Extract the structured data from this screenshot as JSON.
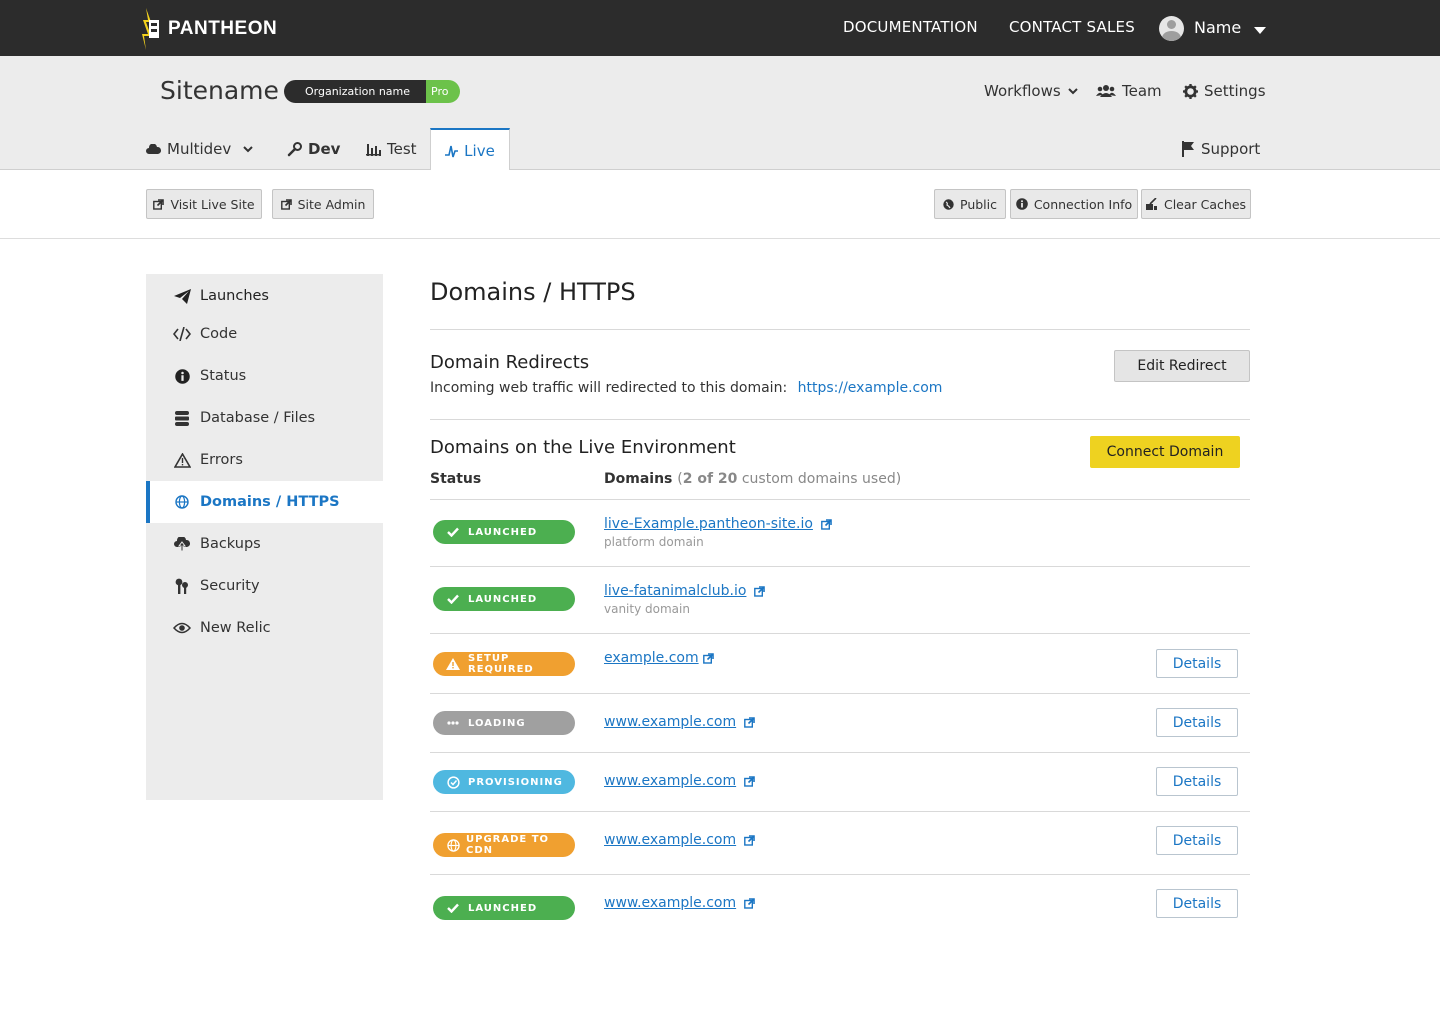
{
  "topbar": {
    "logo_text": "PANTHEON",
    "links": [
      "DOCUMENTATION",
      "CONTACT SALES"
    ],
    "user_name": "Name"
  },
  "site": {
    "name": "Sitename",
    "org_name": "Organization name",
    "plan": "Pro",
    "workflows": "Workflows",
    "team": "Team",
    "settings": "Settings",
    "support": "Support"
  },
  "env_tabs": [
    "Multidev",
    "Dev",
    "Test",
    "Live"
  ],
  "actions": {
    "visit_live": "Visit Live Site",
    "site_admin": "Site Admin",
    "public": "Public",
    "connection_info": "Connection Info",
    "clear_caches": "Clear Caches"
  },
  "sidebar": {
    "items": [
      {
        "label": "Launches",
        "icon": "paper-plane-icon"
      },
      {
        "label": "Code",
        "icon": "code-icon"
      },
      {
        "label": "Status",
        "icon": "info-icon"
      },
      {
        "label": "Database / Files",
        "icon": "database-icon"
      },
      {
        "label": "Errors",
        "icon": "warning-icon"
      },
      {
        "label": "Domains / HTTPS",
        "icon": "globe-icon"
      },
      {
        "label": "Backups",
        "icon": "cloud-upload-icon"
      },
      {
        "label": "Security",
        "icon": "keys-icon"
      },
      {
        "label": "New Relic",
        "icon": "eye-icon"
      }
    ],
    "active": "Domains / HTTPS"
  },
  "main": {
    "title": "Domains / HTTPS",
    "redirects": {
      "title": "Domain Redirects",
      "text": "Incoming web traffic will redirected to this domain:",
      "link": "https://example.com",
      "button": "Edit Redirect"
    },
    "domains": {
      "title": "Domains on the Live Environment",
      "button": "Connect Domain",
      "col_status": "Status",
      "col_domains": "Domains",
      "usage_open": "(",
      "usage_count": "2 of 20",
      "usage_rest": " custom domains used)",
      "rows": [
        {
          "status": "LAUNCHED",
          "color": "#4caf50",
          "icon": "check-icon",
          "domain": "live-Example.pantheon-site.io",
          "sub": "platform domain",
          "details": ""
        },
        {
          "status": "LAUNCHED",
          "color": "#4caf50",
          "icon": "check-icon",
          "domain": "live-fatanimalclub.io",
          "sub": "vanity domain",
          "details": ""
        },
        {
          "status": "SETUP REQUIRED",
          "color": "#f0a030",
          "icon": "warning-icon",
          "domain": "example.com",
          "sub": "",
          "details": "Details"
        },
        {
          "status": "LOADING",
          "color": "#a0a0a0",
          "icon": "ellipsis-icon",
          "domain": "www.example.com",
          "sub": "",
          "details": "Details"
        },
        {
          "status": "PROVISIONING",
          "color": "#4fb8e0",
          "icon": "sync-icon",
          "domain": "www.example.com",
          "sub": "",
          "details": "Details"
        },
        {
          "status": "UPGRADE TO CDN",
          "color": "#f0a030",
          "icon": "globe-icon",
          "domain": "www.example.com",
          "sub": "",
          "details": "Details"
        },
        {
          "status": "LAUNCHED",
          "color": "#4caf50",
          "icon": "check-icon",
          "domain": "www.example.com",
          "sub": "",
          "details": "Details"
        }
      ]
    }
  }
}
